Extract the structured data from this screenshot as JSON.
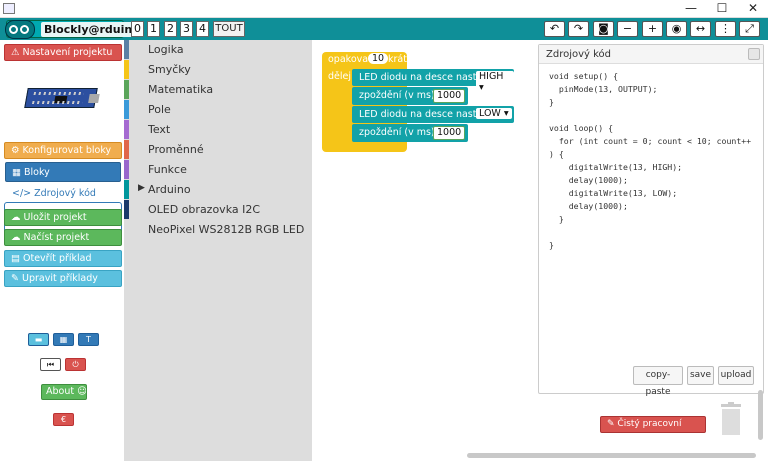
{
  "window": {
    "minimize": "—",
    "maximize": "☐",
    "close": "✕"
  },
  "header": {
    "logo_text": "Blockly@rduino",
    "levels": [
      "0",
      "1",
      "2",
      "3",
      "4"
    ],
    "tout": "TOUT"
  },
  "toolbar": {
    "icons": [
      "undo-icon",
      "redo-icon",
      "camera-icon",
      "zoom-out-icon",
      "zoom-in-icon",
      "eye-icon",
      "arrows-horizontal-icon",
      "more-icon",
      "expand-icon"
    ],
    "glyphs": [
      "↶",
      "↷",
      "◙",
      "−",
      "+",
      "◉",
      "↔",
      "⋮",
      "⤢"
    ]
  },
  "left": {
    "settings": "Nastavení projektu",
    "configure": "Konfigurovat bloky",
    "tab_blocks": "Bloky",
    "tab_code": "Zdrojový kód",
    "save": "Uložit projekt",
    "load": "Načíst projekt",
    "open_example": "Otevřít příklad",
    "edit_examples": "Upravit příklady",
    "about": "About",
    "euro": "€"
  },
  "categories": [
    {
      "label": "Logika",
      "color": "#5b80a5"
    },
    {
      "label": "Smyčky",
      "color": "#f5c518"
    },
    {
      "label": "Matematika",
      "color": "#5ba55b"
    },
    {
      "label": "Pole",
      "color": "#3a9ad9"
    },
    {
      "label": "Text",
      "color": "#a56bd1"
    },
    {
      "label": "Proměnné",
      "color": "#e0664a"
    },
    {
      "label": "Funkce",
      "color": "#9966cc"
    },
    {
      "label": "Arduino",
      "color": "#00979c",
      "arrow": "▶"
    },
    {
      "label": "OLED obrazovka I2C",
      "color": "#1a3a6b"
    },
    {
      "label": "NeoPixel WS2812B RGB LED",
      "color": "#dddddd"
    }
  ],
  "blocks": {
    "repeat_label": "opakovat",
    "repeat_count": "10",
    "repeat_times": "krát",
    "do_label": "dělej",
    "led_label": "LED diodu na desce nastavit",
    "high": "HIGH",
    "low": "LOW",
    "delay_label": "zpoždění (v ms)",
    "delay_value": "1000"
  },
  "code": {
    "title": "Zdrojový kód",
    "source": "void setup() {\n  pinMode(13, OUTPUT);\n}\n\nvoid loop() {\n  for (int count = 0; count < 10; count++\n) {\n    digitalWrite(13, HIGH);\n    delay(1000);\n    digitalWrite(13, LOW);\n    delay(1000);\n  }\n\n}",
    "copy": "copy-paste",
    "save": "save",
    "upload": "upload"
  },
  "workspace": {
    "clear": "Čistý pracovní prostor"
  },
  "colors": {
    "teal": "#0f8f98",
    "block_teal": "#12a2a8",
    "loop_yellow": "#f5c518"
  }
}
